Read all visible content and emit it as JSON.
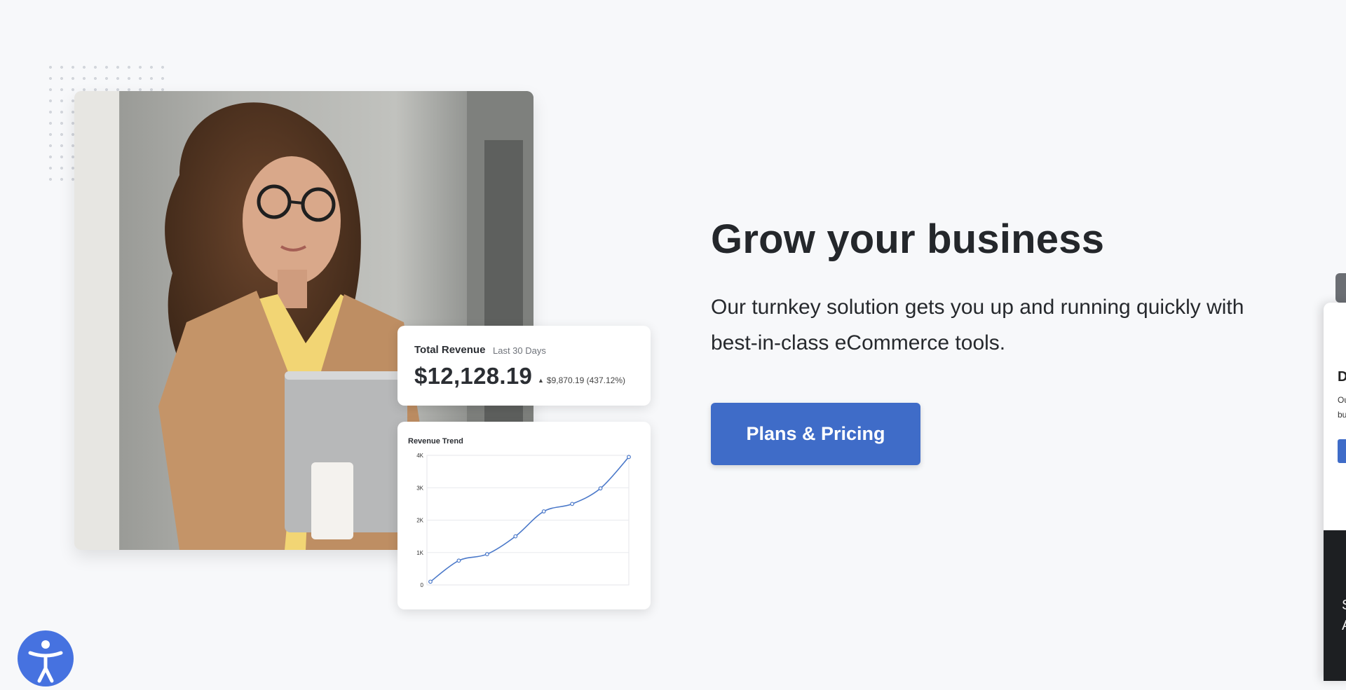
{
  "hero": {
    "headline": "Grow your business",
    "subtext": "Our turnkey solution gets you up and running quickly with best-in-class eCommerce tools.",
    "cta_label": "Plans & Pricing"
  },
  "revenue_card": {
    "title": "Total Revenue",
    "period": "Last 30 Days",
    "amount": "$12,128.19",
    "change": "$9,870.19 (437.12%)"
  },
  "trend_card": {
    "title": "Revenue Trend"
  },
  "chart_data": {
    "type": "line",
    "title": "Revenue Trend",
    "xlabel": "",
    "ylabel": "",
    "ylim": [
      0,
      4000
    ],
    "y_ticks": [
      "0",
      "1K",
      "2K",
      "3K",
      "4K"
    ],
    "grid": true,
    "series": [
      {
        "values": [
          100,
          750,
          950,
          1500,
          2270,
          2500,
          2980,
          3950
        ]
      }
    ]
  },
  "side_panel": {
    "heading": "D",
    "line1": "Ou",
    "line2": "bu",
    "dark_line1": "",
    "dark_line2": "S",
    "dark_line3": "A"
  },
  "colors": {
    "accent": "#3f6cc8",
    "accessibility_button": "#4672e0",
    "line": "#4a78c9"
  },
  "icons": {
    "accessibility": "accessibility-person-icon",
    "change_arrow": "triangle-up-icon"
  }
}
